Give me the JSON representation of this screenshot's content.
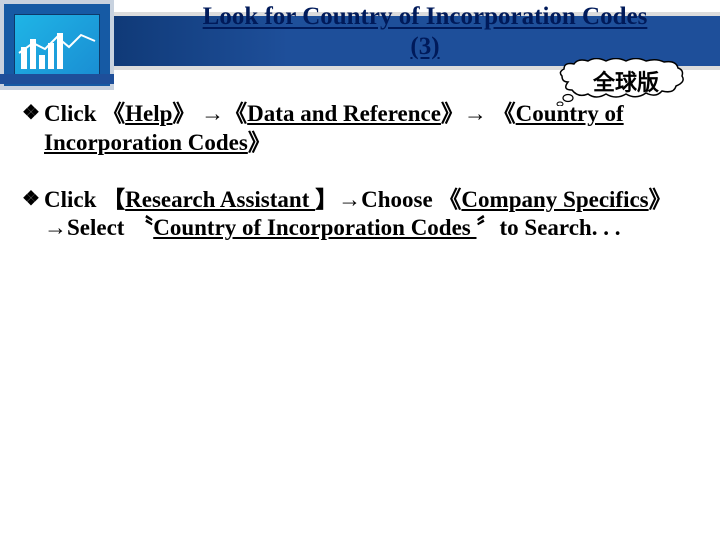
{
  "header": {
    "title_line1": "Look for Country of Incorporation Codes",
    "title_line2": "(3)"
  },
  "badge": {
    "text": "全球版"
  },
  "bullets": [
    {
      "segments": {
        "s0": "Click 《",
        "s1": "Help",
        "s2": "》 →《",
        "s3": "Data and Reference",
        "s4": "》→ 《",
        "s5": "Country of Incorporation Codes",
        "s6": "》"
      }
    },
    {
      "segments": {
        "s0": "Click 【",
        "s1": "Research Assistant ",
        "s2": "】→Choose 《",
        "s3": "Company Specifics",
        "s4": "》 →Select 〝",
        "s5": "Country of Incorporation Codes ",
        "s6": "〞to Search. . ."
      }
    }
  ]
}
